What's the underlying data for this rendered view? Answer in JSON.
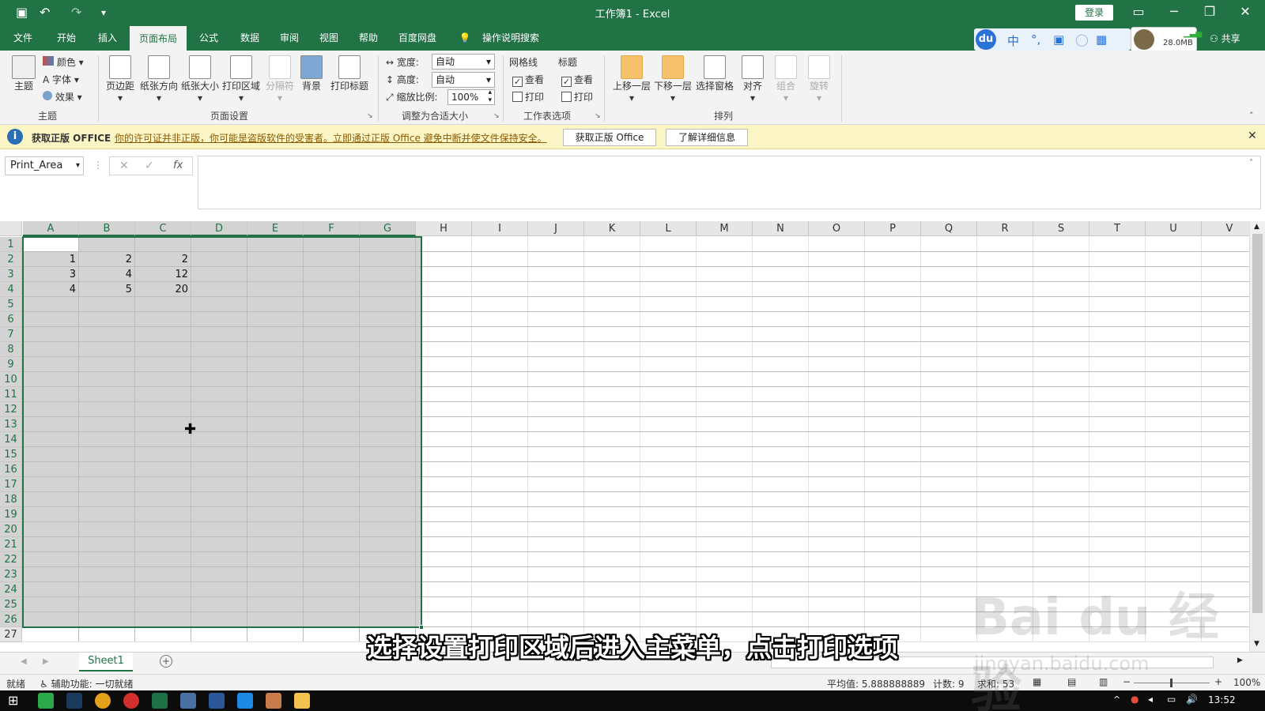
{
  "title_bar": {
    "title": "工作簿1  -  Excel",
    "login_label": "登录"
  },
  "menu_tabs": [
    {
      "label": "文件"
    },
    {
      "label": "开始"
    },
    {
      "label": "插入"
    },
    {
      "label": "页面布局"
    },
    {
      "label": "公式"
    },
    {
      "label": "数据"
    },
    {
      "label": "审阅"
    },
    {
      "label": "视图"
    },
    {
      "label": "帮助"
    },
    {
      "label": "百度网盘"
    },
    {
      "label": "操作说明搜索"
    }
  ],
  "share_label": "共享",
  "ime_size": "28.0MB",
  "ribbon": {
    "theme": {
      "main_label": "主题",
      "color_label": "颜色",
      "font_label": "字体",
      "effect_label": "效果",
      "group_label": "主题"
    },
    "page_setup": {
      "margins_label": "页边距",
      "orientation_label": "纸张方向",
      "size_label": "纸张大小",
      "print_area_label": "打印区域",
      "breaks_label": "分隔符",
      "background_label": "背景",
      "print_titles_label": "打印标题",
      "group_label": "页面设置"
    },
    "scale_to_fit": {
      "width_label": "宽度:",
      "width_value": "自动",
      "height_label": "高度:",
      "height_value": "自动",
      "scale_label": "缩放比例:",
      "scale_value": "100%",
      "group_label": "调整为合适大小"
    },
    "sheet_options": {
      "gridlines_label": "网格线",
      "headings_label": "标题",
      "view_label": "查看",
      "print_label": "打印",
      "group_label": "工作表选项"
    },
    "arrange": {
      "bring_forward_label": "上移一层",
      "send_backward_label": "下移一层",
      "selection_pane_label": "选择窗格",
      "align_label": "对齐",
      "group_obj_label": "组合",
      "rotate_label": "旋转",
      "group_label": "排列"
    }
  },
  "notice": {
    "title": "获取正版 OFFICE",
    "message": "你的许可证并非正版，你可能是盗版软件的受害者。立即通过正版 Office 避免中断并使文件保持安全。",
    "get_button": "获取正版 Office",
    "learn_button": "了解详细信息"
  },
  "formula_bar": {
    "name_box": "Print_Area",
    "fx_label": "fx"
  },
  "columns": [
    "A",
    "B",
    "C",
    "D",
    "E",
    "F",
    "G",
    "H",
    "I",
    "J",
    "K",
    "L",
    "M",
    "N",
    "O",
    "P",
    "Q",
    "R",
    "S",
    "T",
    "U",
    "V"
  ],
  "rows": [
    "1",
    "2",
    "3",
    "4",
    "5",
    "6",
    "7",
    "8",
    "9",
    "10",
    "11",
    "12",
    "13",
    "14",
    "15",
    "16",
    "17",
    "18",
    "19",
    "20",
    "21",
    "22",
    "23",
    "24",
    "25",
    "26",
    "27"
  ],
  "cells": [
    {
      "ref": "A2",
      "value": "1"
    },
    {
      "ref": "B2",
      "value": "2"
    },
    {
      "ref": "C2",
      "value": "2"
    },
    {
      "ref": "A3",
      "value": "3"
    },
    {
      "ref": "B3",
      "value": "4"
    },
    {
      "ref": "C3",
      "value": "12"
    },
    {
      "ref": "A4",
      "value": "4"
    },
    {
      "ref": "B4",
      "value": "5"
    },
    {
      "ref": "C4",
      "value": "20"
    }
  ],
  "sheet_tab": "Sheet1",
  "status": {
    "ready": "就绪",
    "accessibility": "辅助功能: 一切就绪",
    "average": "平均值: 5.888888889",
    "count": "计数: 9",
    "sum": "求和: 53",
    "zoom": "100%"
  },
  "taskbar": {
    "time": "13:52"
  },
  "subtitle": "选择设置打印区域后进入主菜单，点击打印选项",
  "watermark": "Bai du 经验",
  "watermark_url": "jingyan.baidu.com",
  "colors": {
    "excel_green": "#217346",
    "selection_gray": "#d3d3d3",
    "notice_yellow": "#fcf5c6"
  }
}
